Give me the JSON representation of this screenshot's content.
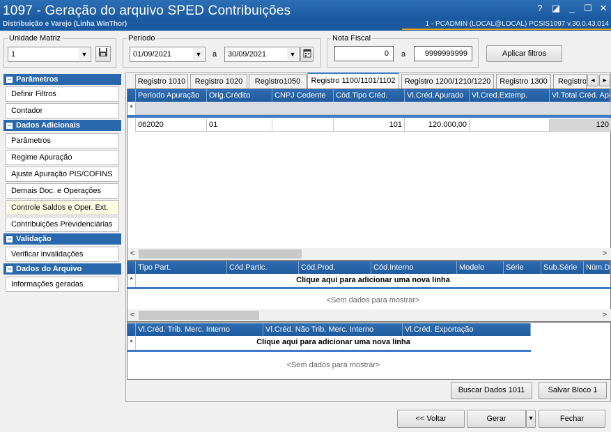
{
  "window": {
    "title": "1097 - Geração do arquivo SPED Contribuições",
    "subtitle": "Distribuição e Varejo (Linha WinThor)",
    "session": "1 - PCADMIN (LOCAL@LOCAL)   PCSIS1097  v.30.0.43.014",
    "controls": {
      "help": "?",
      "restore": "◪",
      "minimize": "_",
      "maximize": "☐",
      "close": "✕"
    }
  },
  "filters": {
    "unidade": {
      "label": "Unidade Matriz",
      "value": "1"
    },
    "periodo": {
      "label": "Período",
      "start": "01/09/2021",
      "sep": "a",
      "end": "30/09/2021"
    },
    "nota": {
      "label": "Nota Fiscal",
      "start": "0",
      "sep": "a",
      "end": "9999999999"
    },
    "apply_label": "Aplicar filtros"
  },
  "sidebar": {
    "sections": [
      {
        "title": "Parâmetros",
        "items": [
          "Definir Filtros",
          "Contador"
        ]
      },
      {
        "title": "Dados Adicionais",
        "items": [
          "Parâmetros",
          "Regime Apuração",
          "Ajuste Apuração PIS/COFINS",
          "Demais Doc. e Operações",
          "Controle Saldos e Oper. Ext.",
          "Contribuições Previdenciárias"
        ]
      },
      {
        "title": "Validação",
        "items": [
          "Verificar invalidações"
        ]
      },
      {
        "title": "Dados do Arquivo",
        "items": [
          "Informações geradas"
        ]
      }
    ]
  },
  "tabs": [
    "Registro 1010",
    "Registro 1020",
    "Registro1050",
    "Registro 1100/1101/1102",
    "Registro 1200/1210/1220",
    "Registro 1300",
    "Registro"
  ],
  "active_tab": "Registro 1100/1101/1102",
  "grid1": {
    "columns": [
      "Período Apuração",
      "Orig.Crédito",
      "CNPJ Cedente",
      "Cód.Tipo Créd.",
      "Vl.Créd.Apurado",
      "Vl.Cred.Extemp.",
      "Vl.Total Créd. Apu"
    ],
    "new_row_marker": "*",
    "rows": [
      [
        "062020",
        "01",
        "",
        "101",
        "120.000,00",
        "",
        "120"
      ]
    ]
  },
  "grid2": {
    "columns": [
      "Tipo Part.",
      "Cód.Partic.",
      "Cód.Prod.",
      "Cód.Interno",
      "Modelo",
      "Série",
      "Sub.Série",
      "Núm.Do"
    ],
    "new_row_marker": "*",
    "add_row": "Clique aqui para adicionar uma nova linha",
    "empty": "<Sem dados para mostrar>"
  },
  "grid3": {
    "columns": [
      "Vl.Créd. Trib. Merc. Interno",
      "Vl.Créd. Não Trib. Merc. Interno",
      "Vl.Créd. Exportação"
    ],
    "new_row_marker": "*",
    "add_row": "Clique aqui para adicionar uma nova linha",
    "empty": "<Sem dados para mostrar>"
  },
  "scroll_glyphs": {
    "left": "<",
    "right": ">",
    "tab_left": "◂",
    "tab_right": "▸"
  },
  "buttons": {
    "buscar": "Buscar Dados 1011",
    "salvar": "Salvar Bloco 1",
    "voltar": "<< Voltar",
    "gerar": "Gerar",
    "gerar_dropdown": "▾",
    "fechar": "Fechar"
  }
}
